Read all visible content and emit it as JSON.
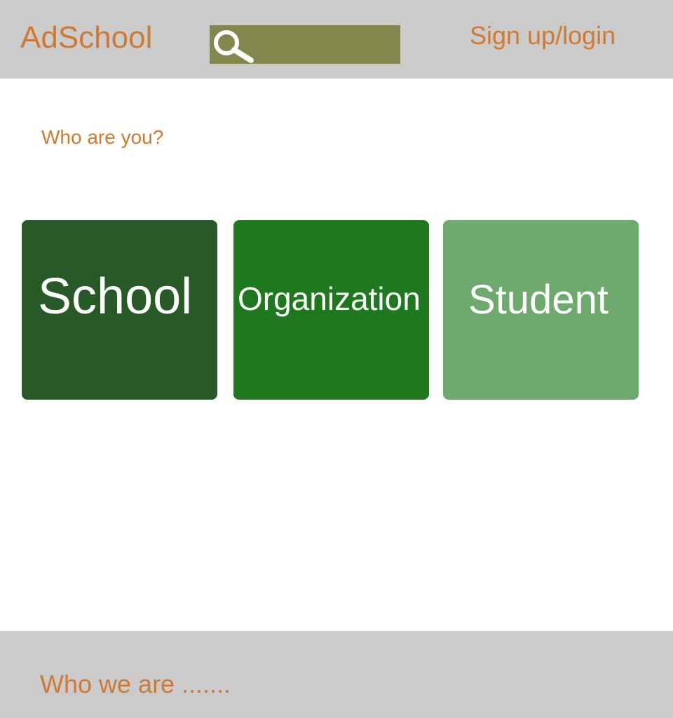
{
  "header": {
    "logo": "AdSchool",
    "search": {
      "value": "",
      "icon": "search-icon"
    },
    "signup_login": "Sign up/login"
  },
  "main": {
    "question": "Who are you?",
    "cards": [
      {
        "label": "School",
        "color": "#275a27"
      },
      {
        "label": "Organization",
        "color": "#1e781e"
      },
      {
        "label": "Student",
        "color": "#6ea96e"
      }
    ]
  },
  "footer": {
    "text": "Who we are ......."
  },
  "colors": {
    "accent": "#cf7a30",
    "bar_background": "#cbcbcb",
    "search_background": "#84874b"
  }
}
